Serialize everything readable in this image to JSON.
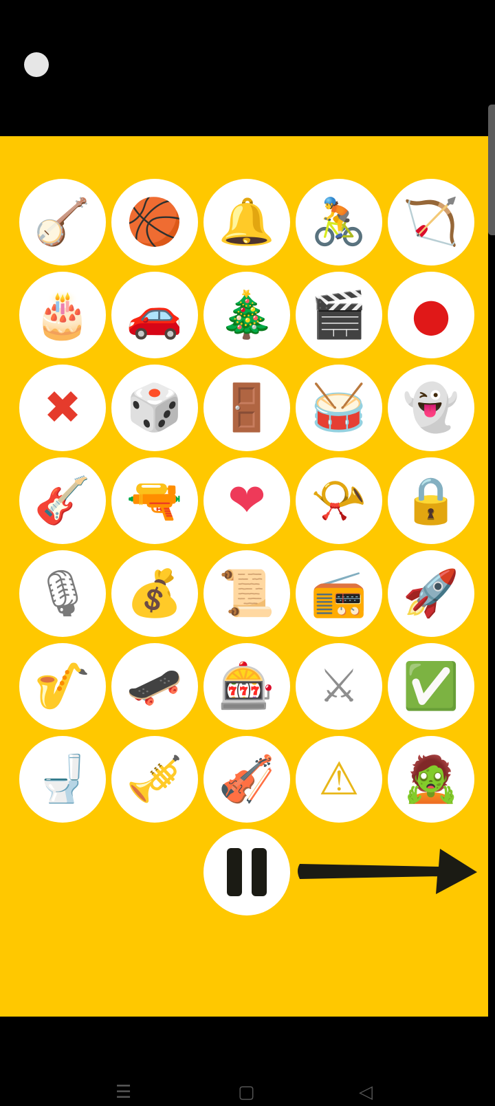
{
  "colors": {
    "board": "#ffc800",
    "tile": "#ffffff",
    "control": "#1b1b14"
  },
  "tiles": [
    {
      "icon": "banjo-icon",
      "glyph": "🪕",
      "color": "#8d5a2b"
    },
    {
      "icon": "basketball-icon",
      "glyph": "🏀",
      "color": "#e8661a"
    },
    {
      "icon": "bell-icon",
      "glyph": "🔔",
      "color": "#f5b21e"
    },
    {
      "icon": "cyclist-icon",
      "glyph": "🚴",
      "color": "#e97a22"
    },
    {
      "icon": "bow-and-arrow-icon",
      "glyph": "🏹",
      "color": "#c0392b"
    },
    {
      "icon": "birthday-cake-icon",
      "glyph": "🎂",
      "color": "#7a4a2b"
    },
    {
      "icon": "car-icon",
      "glyph": "🚗",
      "color": "#d62828"
    },
    {
      "icon": "christmas-tree-icon",
      "glyph": "🎄",
      "color": "#2e8b3a"
    },
    {
      "icon": "clapper-board-icon",
      "glyph": "🎬",
      "color": "#2b2b2b"
    },
    {
      "icon": "red-circle-icon",
      "glyph": "●",
      "color": "#e01818"
    },
    {
      "icon": "cross-mark-icon",
      "glyph": "✖",
      "color": "#e53b2c"
    },
    {
      "icon": "game-die-icon",
      "glyph": "🎲",
      "color": "#333333"
    },
    {
      "icon": "door-icon",
      "glyph": "🚪",
      "color": "#8a5230"
    },
    {
      "icon": "drum-icon",
      "glyph": "🥁",
      "color": "#c0392b"
    },
    {
      "icon": "ghost-icon",
      "glyph": "👻",
      "color": "#444444"
    },
    {
      "icon": "guitar-icon",
      "glyph": "🎸",
      "color": "#c0392b"
    },
    {
      "icon": "pistol-icon",
      "glyph": "🔫",
      "color": "#555555"
    },
    {
      "icon": "heart-icon",
      "glyph": "❤",
      "color": "#ee3a59"
    },
    {
      "icon": "postal-horn-icon",
      "glyph": "📯",
      "color": "#d79a12"
    },
    {
      "icon": "lock-icon",
      "glyph": "🔒",
      "color": "#e0a81a"
    },
    {
      "icon": "microphone-icon",
      "glyph": "🎙",
      "color": "#7a7a7a"
    },
    {
      "icon": "money-bag-icon",
      "glyph": "💰",
      "color": "#e0a81a"
    },
    {
      "icon": "scroll-icon",
      "glyph": "📜",
      "color": "#444444"
    },
    {
      "icon": "radio-icon",
      "glyph": "📻",
      "color": "#777777"
    },
    {
      "icon": "rocket-icon",
      "glyph": "🚀",
      "color": "#d5342b"
    },
    {
      "icon": "saxophone-icon",
      "glyph": "🎷",
      "color": "#d79a12"
    },
    {
      "icon": "skateboard-icon",
      "glyph": "🛹",
      "color": "#2c6fd6"
    },
    {
      "icon": "slot-machine-icon",
      "glyph": "🎰",
      "color": "#555555"
    },
    {
      "icon": "crossed-swords-icon",
      "glyph": "⚔",
      "color": "#8e8e8e"
    },
    {
      "icon": "check-box-icon",
      "glyph": "✅",
      "color": "#2fb148"
    },
    {
      "icon": "toilet-icon",
      "glyph": "🚽",
      "color": "#777777"
    },
    {
      "icon": "trumpet-icon",
      "glyph": "🎺",
      "color": "#d79a12"
    },
    {
      "icon": "violin-icon",
      "glyph": "🎻",
      "color": "#9b4a1e"
    },
    {
      "icon": "warning-icon",
      "glyph": "⚠",
      "color": "#e8b71a"
    },
    {
      "icon": "zombie-icon",
      "glyph": "🧟",
      "color": "#3aa23a"
    }
  ],
  "controls": {
    "pause": {
      "icon": "pause-icon"
    },
    "next": {
      "icon": "arrow-right-icon"
    }
  },
  "nav": {
    "recents": {
      "icon": "recents-icon",
      "glyph": "☰"
    },
    "home": {
      "icon": "home-icon",
      "glyph": "▢"
    },
    "back": {
      "icon": "back-icon",
      "glyph": "◁"
    }
  }
}
